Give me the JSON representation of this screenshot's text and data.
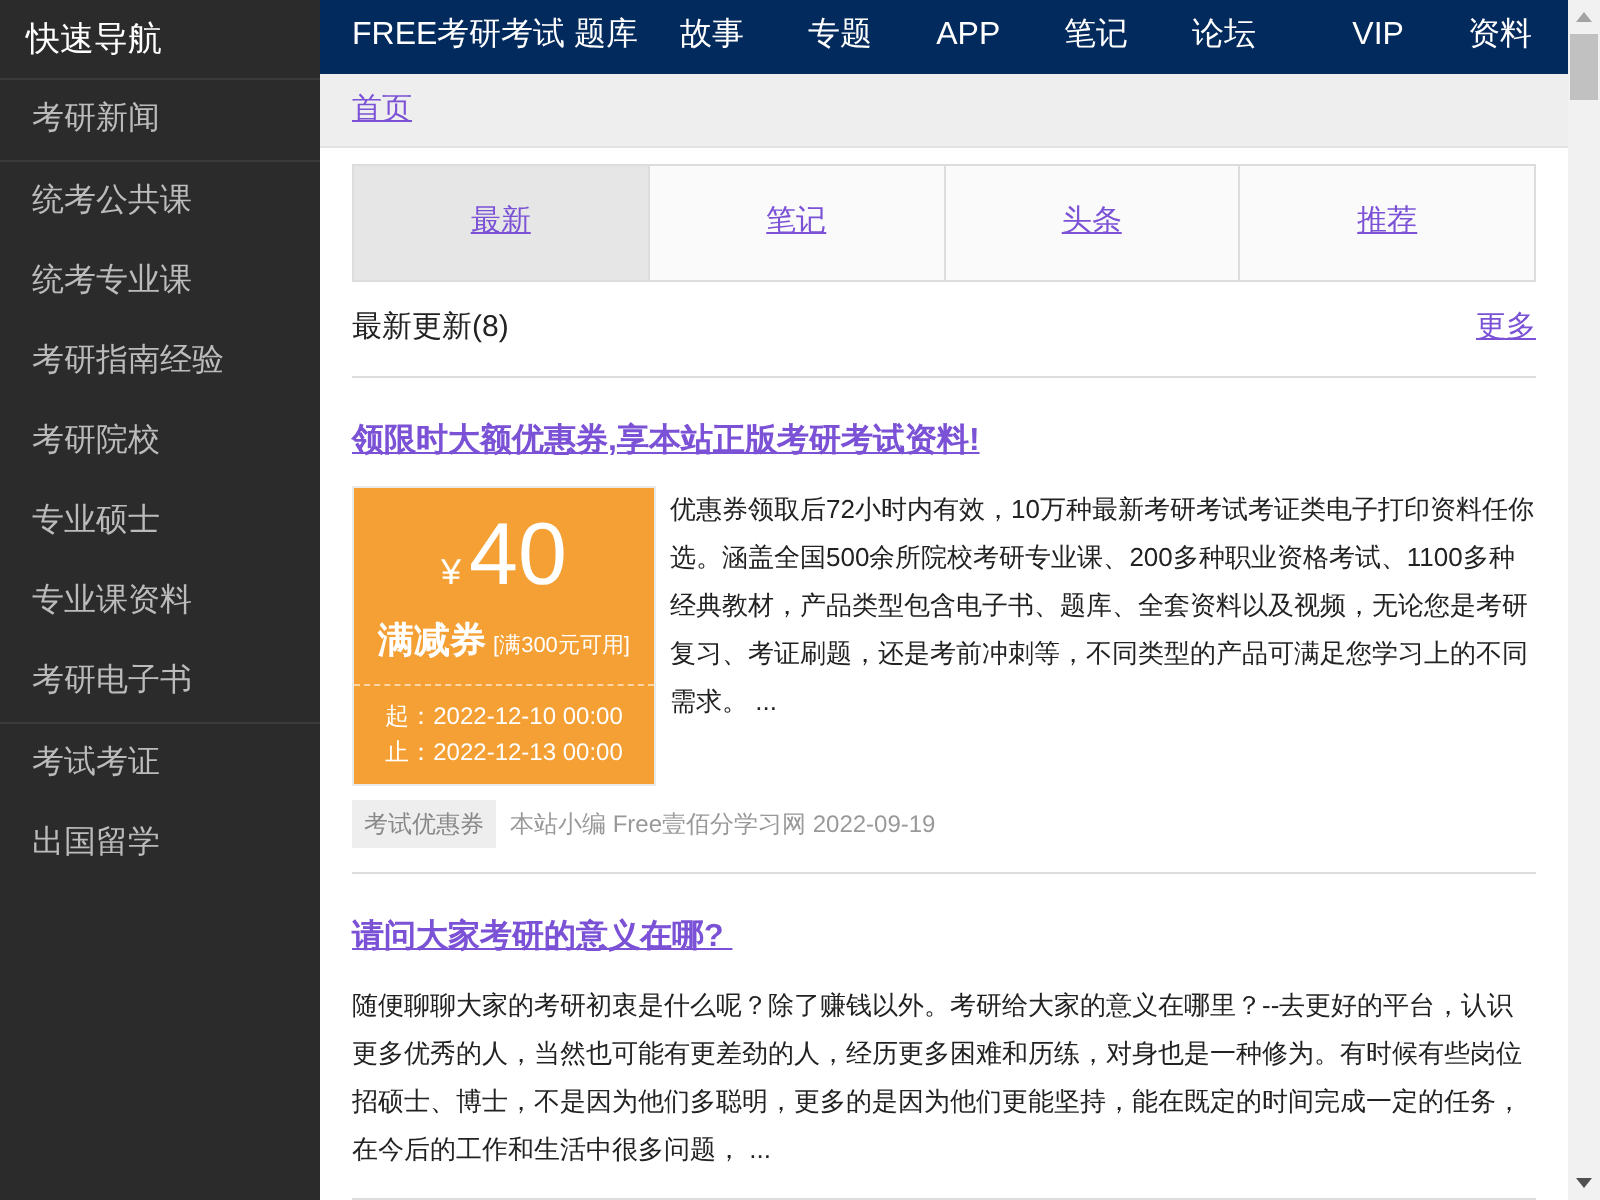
{
  "sidebar": {
    "title": "快速导航",
    "groups": [
      {
        "items": [
          "考研新闻"
        ]
      },
      {
        "items": [
          "统考公共课",
          "统考专业课",
          "考研指南经验",
          "考研院校",
          "专业硕士",
          "专业课资料",
          "考研电子书"
        ]
      },
      {
        "items": [
          "考试考证",
          "出国留学"
        ]
      }
    ]
  },
  "top_nav": {
    "brand": "FREE考研考试 题库",
    "links": [
      "故事",
      "专题",
      "APP",
      "笔记",
      "论坛",
      "VIP",
      "资料"
    ]
  },
  "breadcrumb": [
    "首页"
  ],
  "tabs": [
    {
      "label": "最新",
      "selected": true
    },
    {
      "label": "笔记",
      "selected": false
    },
    {
      "label": "头条",
      "selected": false
    },
    {
      "label": "推荐",
      "selected": false
    }
  ],
  "section": {
    "title": "最新更新(8)",
    "more": "更多"
  },
  "articles": [
    {
      "kind": "coupon",
      "title": "领限时大额优惠券,享本站正版考研考试资料!",
      "coupon": {
        "currency": "¥",
        "amount": "40",
        "name": "满减券",
        "condition": "[满300元可用]",
        "start": "起：2022-12-10 00:00",
        "end": "止：2022-12-13 00:00"
      },
      "summary": "优惠券领取后72小时内有效，10万种最新考研考试考证类电子打印资料任你选。涵盖全国500余所院校考研专业课、200多种职业资格考试、1100多种经典教材，产品类型包含电子书、题库、全套资料以及视频，无论您是考研复习、考证刷题，还是考前冲刺等，不同类型的产品可满足您学习上的不同需求。 ...",
      "tag": "考试优惠券",
      "meta": "本站小编 Free壹佰分学习网 2022-09-19"
    },
    {
      "kind": "text",
      "title": "请问大家考研的意义在哪? ",
      "summary": "随便聊聊大家的考研初衷是什么呢？除了赚钱以外。考研给大家的意义在哪里？--去更好的平台，认识更多优秀的人，当然也可能有更差劲的人，经历更多困难和历练，对身也是一种修为。有时候有些岗位招硕士、博士，不是因为他们多聪明，更多的是因为他们更能坚持，能在既定的时间完成一定的任务，在今后的工作和生活中很多问题， ..."
    }
  ]
}
